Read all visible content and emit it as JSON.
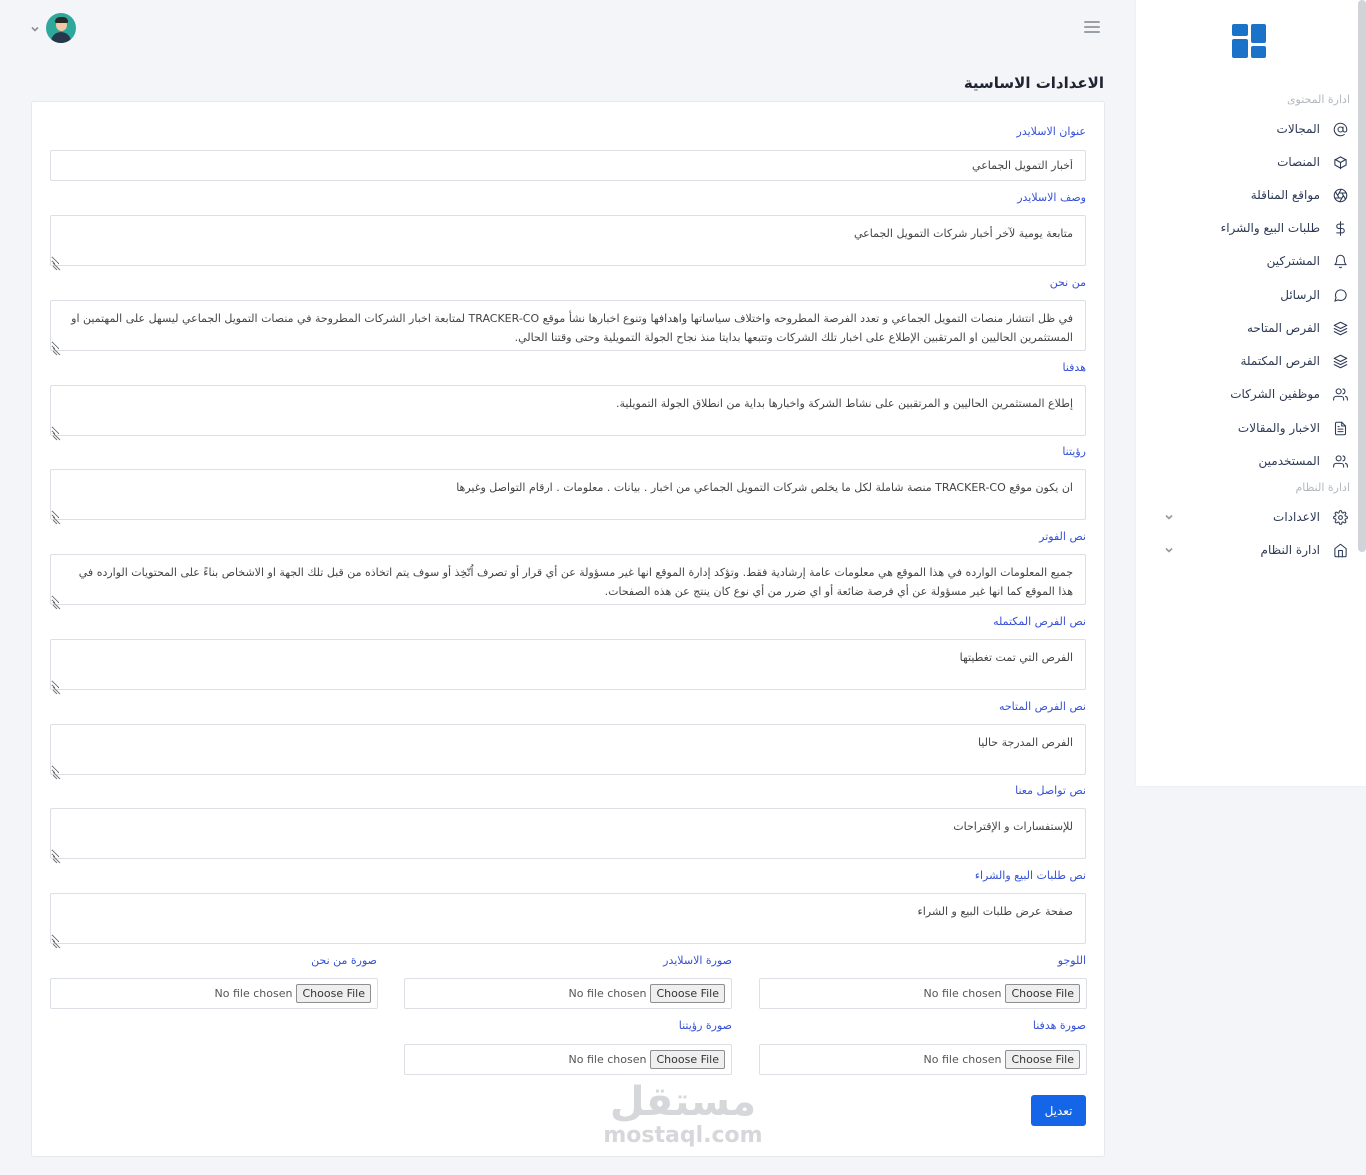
{
  "sidebar": {
    "sections": [
      "ادارة المحتوى",
      "ادارة النظام"
    ],
    "items": [
      {
        "label": "المجالات"
      },
      {
        "label": "المنصات"
      },
      {
        "label": "مواقع المناقلة"
      },
      {
        "label": "طلبات البيع والشراء"
      },
      {
        "label": "المشتركين"
      },
      {
        "label": "الرسائل"
      },
      {
        "label": "الفرص المتاحه"
      },
      {
        "label": "الفرص المكتملة"
      },
      {
        "label": "موظفين الشركات"
      },
      {
        "label": "الاخبار والمقالات"
      },
      {
        "label": "المستخدمين"
      },
      {
        "label": "الاعدادات"
      },
      {
        "label": "ادارة النظام"
      }
    ]
  },
  "page": {
    "title": "الاعدادات الاساسية"
  },
  "form": {
    "fields": [
      {
        "label": "عنوان الاسلايدر",
        "value": "أخبار التمويل الجماعي"
      },
      {
        "label": "وصف الاسلايدر",
        "value": "متابعة يومية لآخر أخبار شركات التمويل الجماعي"
      },
      {
        "label": "من نحن",
        "value": "في ظل انتشار منصات التمويل الجماعي و تعدد الفرصة المطروحه واختلاف سياساتها واهدافها وتنوع اخبارها نشأ موقع TRACKER-CO لمتابعة اخبار الشركات المطروحة في منصات التمويل الجماعي ليسهل على المهتمين او المستثمرين الحاليين او المرتقبين الإطلاع على اخبار تلك الشركات وتتبعها بدايتا منذ نجاح الجولة التمويلية وحتى وقتنا الحالي."
      },
      {
        "label": "هدفنا",
        "value": "إطلاع المستثمرين الحاليين و المرتقبين على نشاط الشركة واخبارها بداية من انطلاق الجولة التمويلية."
      },
      {
        "label": "رؤيتنا",
        "value": "ان يكون موقع TRACKER-CO منصة شاملة لكل ما يخلص شركات التمويل الجماعي من اخبار . بيانات . معلومات . ارقام التواصل وغيرها"
      },
      {
        "label": "نص الفوتر",
        "value": "جميع المعلومات الوارده في هذا الموقع هي معلومات عامة إرشادية فقط. وتؤكد إدارة الموقع انها غير مسؤولة عن أي قرار أو تصرف اُتّخِذ أو سوف يتم اتخاذه من قبل تلك الجهة او الاشخاص بناءً على المحتويات الوارده في هذا الموقع كما انها غير مسؤولة عن أي فرصة ضائعة أو اي ضرر من أي نوع كان ينتج عن هذه الصفحات."
      },
      {
        "label": "نص الفرص المكتمله",
        "value": "الفرص التي تمت تغطيتها"
      },
      {
        "label": "نص الفرص المتاحه",
        "value": "الفرص المدرجة حاليا"
      },
      {
        "label": "نص تواصل معنا",
        "value": "للإستفسارات و الإقتراحات"
      },
      {
        "label": "نص طلبات البيع والشراء",
        "value": "صفحة عرض طلبات البيع و الشراء"
      }
    ],
    "files": [
      {
        "label": "اللوجو"
      },
      {
        "label": "صورة الاسلايدر"
      },
      {
        "label": "صورة من نحن"
      },
      {
        "label": "صورة هدفنا"
      },
      {
        "label": "صورة رؤيتنا"
      }
    ],
    "file_button": "Choose File",
    "file_status": "No file chosen",
    "submit_label": "تعديل"
  },
  "watermark": {
    "line1": "مستقل",
    "line2": "mostaql.com"
  }
}
